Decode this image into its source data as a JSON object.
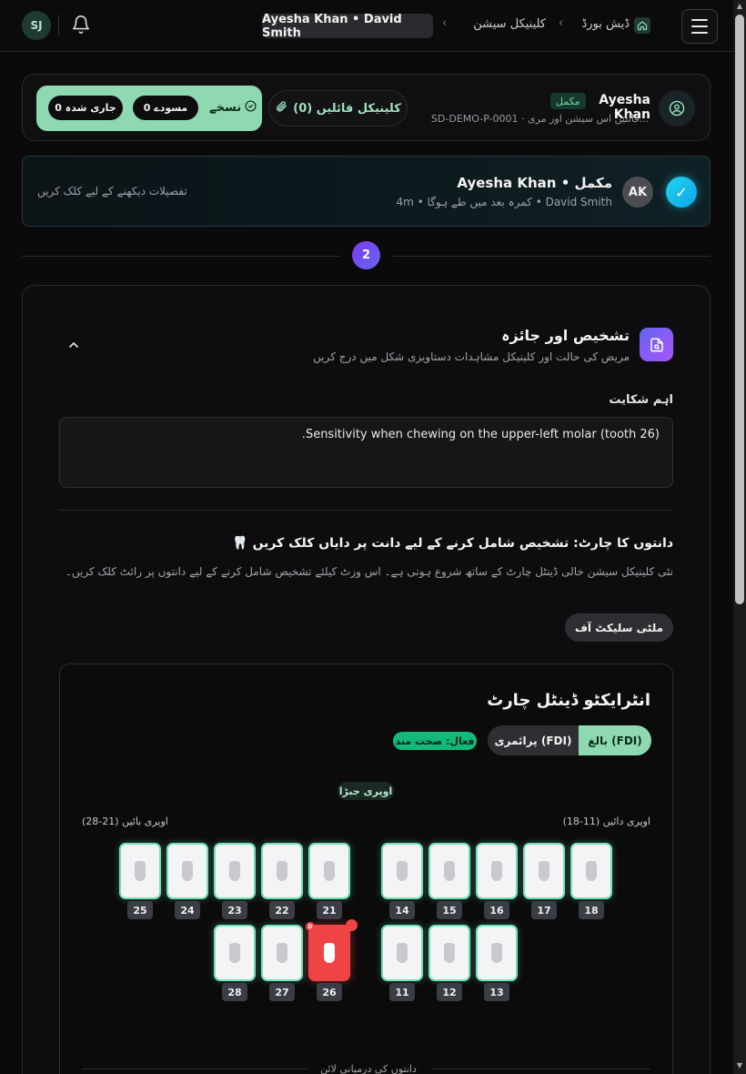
{
  "topbar": {
    "avatar_initials": "SJ",
    "breadcrumb": {
      "dashboard": "ڈیش بورڈ",
      "session": "کلینیکل سیشن",
      "current": "Ayesha Khan • David Smith"
    }
  },
  "patient": {
    "name": "Ayesha Khan",
    "status_badge": "مکمل",
    "subtitle": "SD-DEMO-P-0001 · فائلیں اس سیشن اور مری...",
    "files_button": "کلینیکل فائلیں (0)",
    "copies_label": "نسخے",
    "drafts_pill": "0 مسودے",
    "ongoing_pill": "0 جاری شدہ"
  },
  "session": {
    "avatar_initials": "AK",
    "title": "Ayesha Khan • مکمل",
    "subtitle": "4m • کمرہ بعد میں طے ہوگا • David Smith",
    "hint": "تفصیلات دیکھنے کے لیے کلک کریں"
  },
  "step": {
    "number": "2"
  },
  "section": {
    "title": "تشخیص اور جائزہ",
    "subtitle": "مریض کی حالت اور کلینیکل مشاہدات دستاویزی شکل میں درج کریں",
    "complaint_label": "اہم شکایت",
    "complaint_value": "Sensitivity when chewing on the upper-left molar (tooth 26).",
    "chart_heading": "🦷 دانتوں کا چارٹ: تشخیص شامل کرنے کے لیے دانت پر دایاں کلک کریں",
    "chart_desc": "نئی کلینیکل سیشن خالی ڈینٹل چارٹ کے ساتھ شروع ہوتی ہے۔ اس وزٹ کیلئے تشخیص شامل کرنے کے لیے دانتوں پر رائٹ کلک کریں۔",
    "multiselect_button": "ملٹی سلیکٹ آف"
  },
  "dental_chart": {
    "title": "انٹرایکٹو ڈینٹل چارٹ",
    "tab_adult": "بالغ (FDI)",
    "tab_primary": "پرائمری (FDI)",
    "active_badge": "فعال: صحت مند",
    "upper_jaw_label": "اوپری جبڑا",
    "upper_right_label": "اوپری دائیں (11-18)",
    "upper_left_label": "اوپری بائیں (21-28)",
    "diagnosis_marker": "D",
    "mid_line_label": "دانتوں کی درمیانی لائن",
    "teeth_top_left": [
      "25",
      "24",
      "23",
      "22",
      "21"
    ],
    "teeth_top_right": [
      "14",
      "15",
      "16",
      "17",
      "18"
    ],
    "teeth_bottom_left": [
      "28",
      "27",
      "26"
    ],
    "teeth_bottom_right": [
      "11",
      "12",
      "13"
    ],
    "diagnosed_tooth": "26",
    "colors": {
      "healthy_border": "#6fe3b0",
      "diagnosed": "#ef4444",
      "accent": "#8fd9b1"
    }
  }
}
